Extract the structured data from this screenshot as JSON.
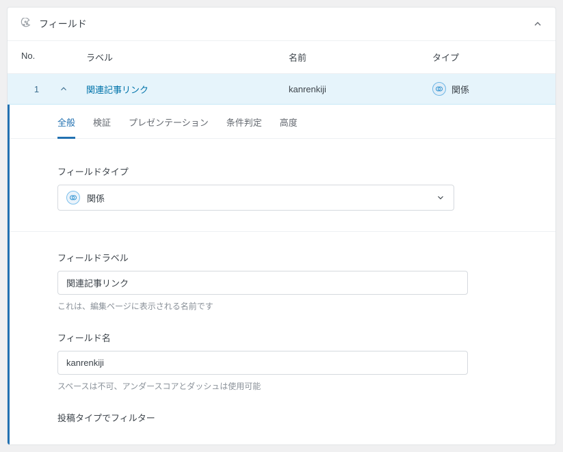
{
  "panel": {
    "title": "フィールド"
  },
  "tableHead": {
    "no": "No.",
    "label": "ラベル",
    "name": "名前",
    "type": "タイプ"
  },
  "row": {
    "no": "1",
    "label": "関連記事リンク",
    "name": "kanrenkiji",
    "type": "関係"
  },
  "tabs": {
    "general": "全般",
    "validation": "検証",
    "presentation": "プレゼンテーション",
    "conditional": "条件判定",
    "advanced": "高度"
  },
  "form": {
    "fieldType": {
      "label": "フィールドタイプ",
      "value": "関係"
    },
    "fieldLabel": {
      "label": "フィールドラベル",
      "value": "関連記事リンク",
      "help": "これは、編集ページに表示される名前です"
    },
    "fieldName": {
      "label": "フィールド名",
      "value": "kanrenkiji",
      "help": "スペースは不可、アンダースコアとダッシュは使用可能"
    },
    "postTypeFilter": {
      "label": "投稿タイプでフィルター"
    }
  }
}
